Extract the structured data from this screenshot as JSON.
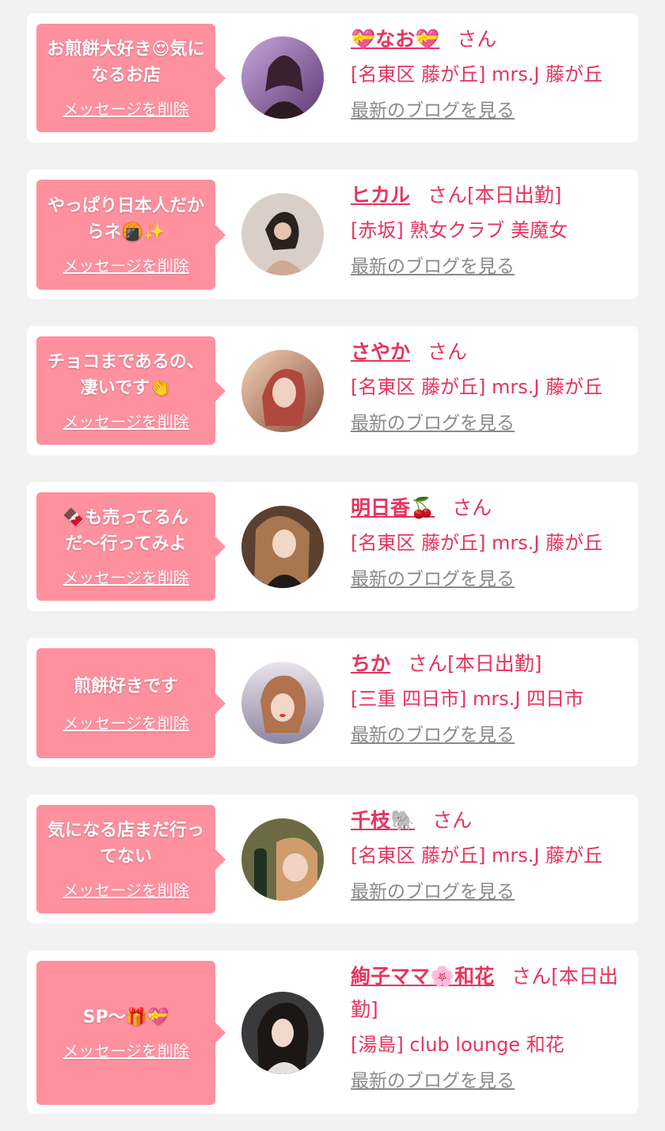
{
  "common": {
    "delete_label": "メッセージを削除",
    "blog_label": "最新のブログを見る",
    "honorific": "さん"
  },
  "items": [
    {
      "message": "お煎餅大好き😍気になるお店",
      "name": "💝なお💝",
      "tag": "",
      "shop": "[名東区 藤が丘] mrs.J 藤が丘"
    },
    {
      "message": "やっぱり日本人だからネ🍘✨",
      "name": "ヒカル",
      "tag": "[本日出勤]",
      "shop": "[赤坂] 熟女クラブ 美魔女"
    },
    {
      "message": "チョコまであるの、凄いです👏",
      "name": "さやか",
      "tag": "",
      "shop": "[名東区 藤が丘] mrs.J 藤が丘"
    },
    {
      "message": "🍫も売ってるんだ〜行ってみよ",
      "name": "明日香🍒",
      "tag": "",
      "shop": "[名東区 藤が丘] mrs.J 藤が丘"
    },
    {
      "message": "煎餅好きです",
      "name": "ちか",
      "tag": "[本日出勤]",
      "shop": "[三重 四日市] mrs.J 四日市"
    },
    {
      "message": "気になる店まだ行ってない",
      "name": "千枝🐘",
      "tag": "",
      "shop": "[名東区 藤が丘] mrs.J 藤が丘"
    },
    {
      "message": "SP〜🎁💝",
      "name": "絢子ママ🌸和花",
      "tag": "[本日出勤]",
      "shop": "[湯島] club lounge 和花"
    }
  ],
  "colors": {
    "page_bg": "#f2f2f2",
    "card_bg": "#ffffff",
    "bubble_bg": "#ff919f",
    "accent": "#e8335e",
    "link_gray": "#8a8a8a"
  }
}
